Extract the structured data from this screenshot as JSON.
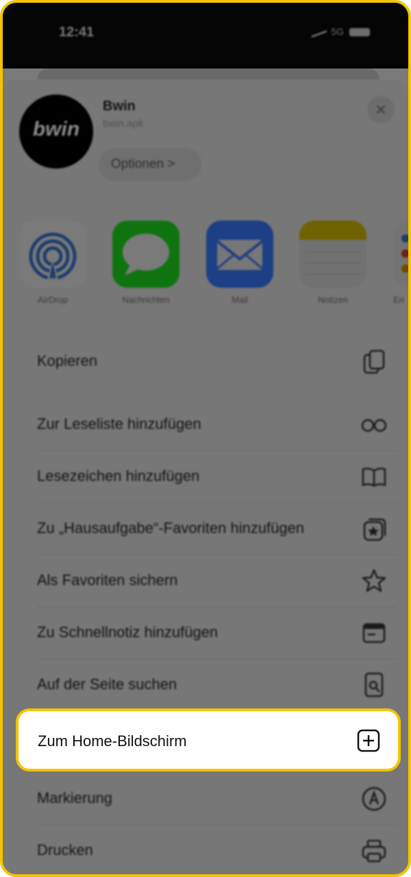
{
  "status_bar": {
    "time": "12:41",
    "network": "5G"
  },
  "share_header": {
    "logo_text": "bwin",
    "app_name": "Bwin",
    "app_subtitle": "bwin.apk",
    "options_label": "Optionen >"
  },
  "share_targets": [
    {
      "label": "AirDrop",
      "icon": "airdrop-icon"
    },
    {
      "label": "Nachrichten",
      "icon": "messages-icon"
    },
    {
      "label": "Mail",
      "icon": "mail-icon"
    },
    {
      "label": "Notizen",
      "icon": "notes-icon"
    },
    {
      "label": "Eri",
      "icon": "reminders-icon"
    }
  ],
  "actions": {
    "copy": {
      "label": "Kopieren",
      "icon": "copy-icon"
    },
    "reading_list": {
      "label": "Zur Leseliste hinzufügen",
      "icon": "glasses-icon"
    },
    "bookmark": {
      "label": "Lesezeichen hinzufügen",
      "icon": "book-icon"
    },
    "favorites_folder": {
      "label": "Zu „Hausaufgabe“-Favoriten hinzufügen",
      "icon": "favorites-folder-icon"
    },
    "save_favorite": {
      "label": "Als Favoriten sichern",
      "icon": "star-icon"
    },
    "quick_note": {
      "label": "Zu Schnellnotiz hinzufügen",
      "icon": "quick-note-icon"
    },
    "find_on_page": {
      "label": "Auf der Seite suchen",
      "icon": "find-on-page-icon"
    },
    "add_to_home": {
      "label": "Zum Home-Bildschirm",
      "icon": "plus-square-icon"
    },
    "markup": {
      "label": "Markierung",
      "icon": "markup-icon"
    },
    "print": {
      "label": "Drucken",
      "icon": "printer-icon"
    }
  },
  "colors": {
    "highlight_border": "#f5c400",
    "dim_overlay": "#777777"
  }
}
